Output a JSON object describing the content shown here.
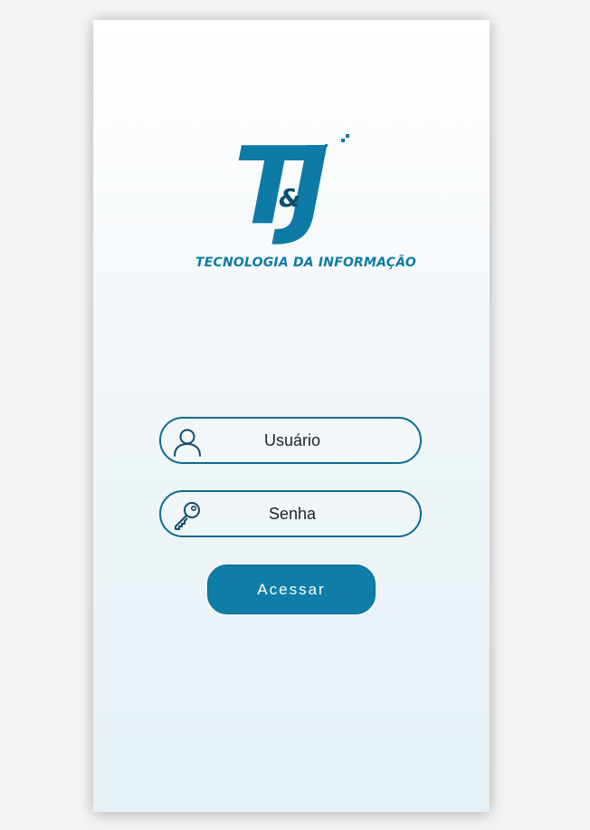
{
  "logo": {
    "letter_t": "T",
    "ampersand": "&",
    "letter_j": "J",
    "subtitle": "TECNOLOGIA DA INFORMAÇÃO"
  },
  "login": {
    "username_placeholder": "Usuário",
    "password_placeholder": "Senha",
    "username_icon": "user-icon",
    "password_icon": "key-icon",
    "submit_label": "Acessar"
  },
  "colors": {
    "brand": "#0f7da8",
    "border": "#0f6b8e",
    "icon": "#134a66"
  }
}
